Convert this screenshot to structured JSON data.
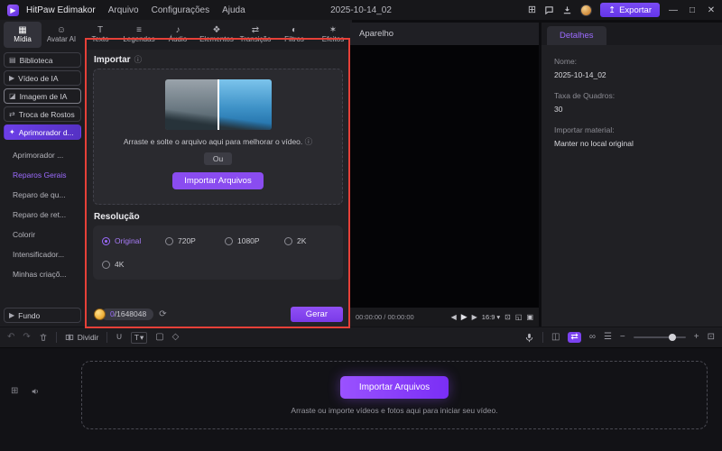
{
  "icons": {
    "logo": "▶",
    "layout": "⊞",
    "export": "↥",
    "minimize": "—",
    "maximize": "□",
    "close": "✕",
    "info": "ⓘ",
    "refresh": "⟳",
    "undo": "↶",
    "redo": "↷",
    "magnet": "∪",
    "text_tool": "T",
    "caret_down": "▾",
    "crop": "▢",
    "keyframe": "◇",
    "prev": "◀",
    "play": "▶",
    "next": "▶",
    "snapshot": "⊡",
    "resize": "◱",
    "pip": "▣",
    "track_view": "◫",
    "ripple": "⇄",
    "link": "∞",
    "tracks": "☰",
    "zoom_out": "−",
    "zoom_in": "+",
    "fit": "⊡",
    "grid": "⊞",
    "separator": "/"
  },
  "titlebar": {
    "app_name": "HitPaw Edimakor",
    "menus": [
      "Arquivo",
      "Configurações",
      "Ajuda"
    ],
    "project_title": "2025-10-14_02",
    "export_label": "Exportar"
  },
  "ribbon": {
    "tabs": [
      {
        "label": "Mídia",
        "icon": "▦",
        "active": true
      },
      {
        "label": "Avatar AI",
        "icon": "☺",
        "active": false
      },
      {
        "label": "Texto",
        "icon": "T",
        "active": false
      },
      {
        "label": "Legendas",
        "icon": "≡",
        "active": false
      },
      {
        "label": "Áudio",
        "icon": "♪",
        "active": false
      },
      {
        "label": "Elementos",
        "icon": "❖",
        "active": false
      },
      {
        "label": "Transição",
        "icon": "⇄",
        "active": false
      },
      {
        "label": "Filtros",
        "icon": "◐",
        "active": false
      },
      {
        "label": "Efeitos",
        "icon": "✶",
        "active": false
      }
    ]
  },
  "sidebar": {
    "items": [
      {
        "label": "Biblioteca",
        "icon": "▤",
        "active": false
      },
      {
        "label": "Vídeo de IA",
        "icon": "▶",
        "active": false
      },
      {
        "label": "Imagem de IA",
        "icon": "◪",
        "active": false
      },
      {
        "label": "Troca de Rostos",
        "icon": "⇄",
        "active": false
      },
      {
        "label": "Aprimorador d...",
        "icon": "✦",
        "active": true
      }
    ],
    "subitems": [
      {
        "label": "Aprimorador ...",
        "active": false
      },
      {
        "label": "Reparos Gerais",
        "active": true
      },
      {
        "label": "Reparo de qu...",
        "active": false
      },
      {
        "label": "Reparo de ret...",
        "active": false
      },
      {
        "label": "Colorir",
        "active": false
      },
      {
        "label": "Intensificador...",
        "active": false
      },
      {
        "label": "Minhas criaçõ...",
        "active": false
      }
    ],
    "footer": {
      "label": "Fundo",
      "icon": "▶"
    }
  },
  "import_panel": {
    "title": "Importar",
    "drop_hint": "Arraste e solte o arquivo aqui para melhorar o vídeo.",
    "or_label": "Ou",
    "import_button": "Importar Arquivos",
    "resolution_title": "Resolução",
    "resolution_options": [
      {
        "label": "Original",
        "selected": true
      },
      {
        "label": "720P",
        "selected": false
      },
      {
        "label": "1080P",
        "selected": false
      },
      {
        "label": "2K",
        "selected": false
      },
      {
        "label": "4K",
        "selected": false
      }
    ],
    "credits_used": "0",
    "credits_total": "1648048",
    "generate_button": "Gerar"
  },
  "preview": {
    "title": "Aparelho",
    "time_current": "00:00:00",
    "time_total": "00:00:00",
    "aspect_ratio": "16:9"
  },
  "details": {
    "tab_label": "Detalhes",
    "fields": [
      {
        "label": "Nome:",
        "value": "2025-10-14_02"
      },
      {
        "label": "Taxa de Quadros:",
        "value": "30"
      },
      {
        "label": "Importar material:",
        "value": "Manter no local original"
      }
    ]
  },
  "toolbar": {
    "split_label": "Dividir"
  },
  "timeline": {
    "import_button": "Importar Arquivos",
    "hint": "Arraste ou importe vídeos e fotos aqui para iniciar seu vídeo."
  }
}
